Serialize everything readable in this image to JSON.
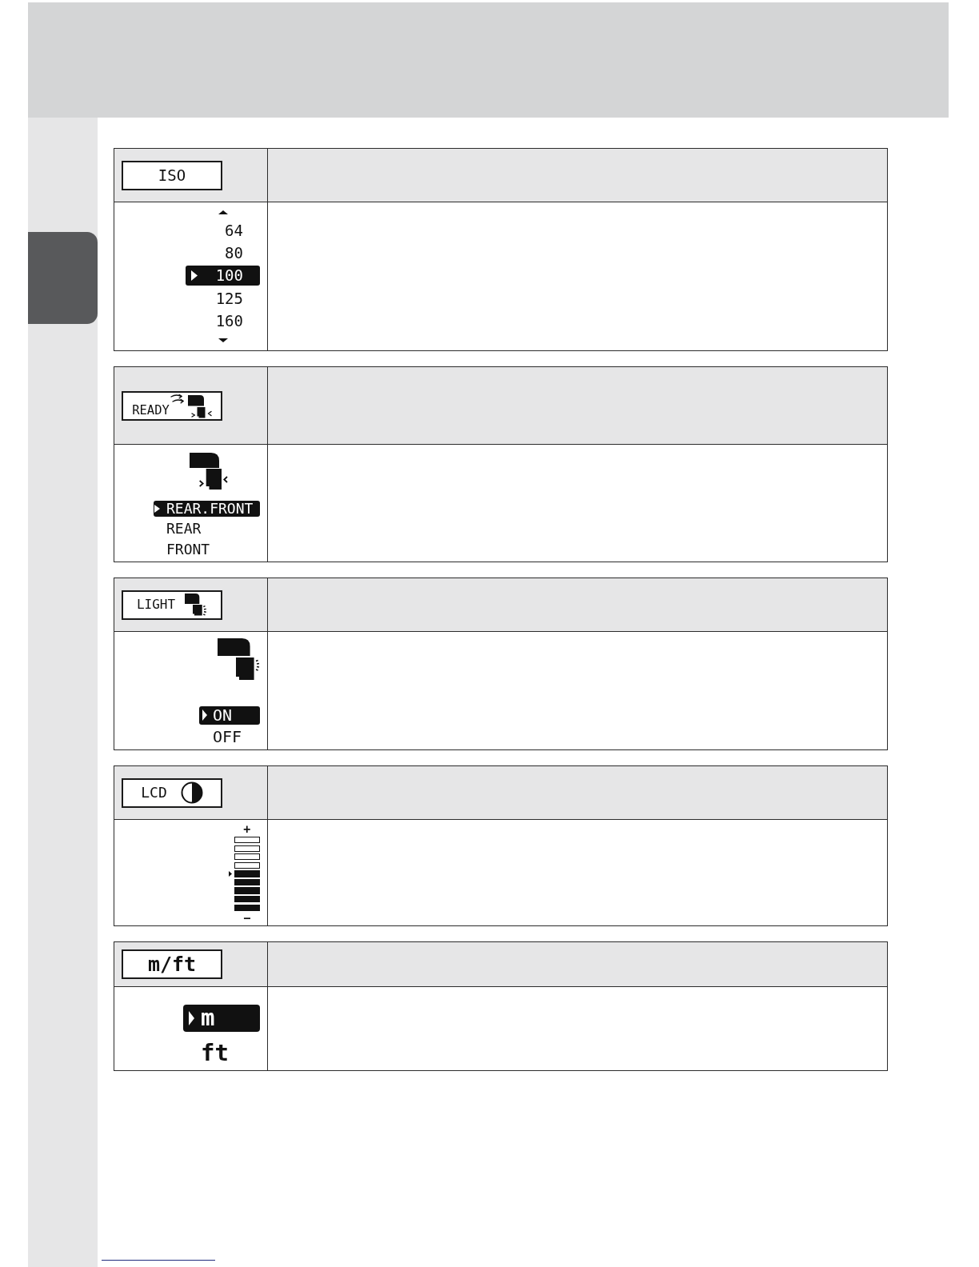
{
  "sections": [
    {
      "kind": "scroll",
      "label": "ISO",
      "options": [
        {
          "text": "64",
          "selected": false
        },
        {
          "text": "80",
          "selected": false
        },
        {
          "text": "100",
          "selected": true
        },
        {
          "text": "125",
          "selected": false
        },
        {
          "text": "160",
          "selected": false
        }
      ]
    },
    {
      "kind": "ready",
      "label": "READY",
      "options": [
        {
          "text": "REAR.FRONT",
          "selected": true
        },
        {
          "text": "REAR",
          "selected": false
        },
        {
          "text": "FRONT",
          "selected": false
        }
      ]
    },
    {
      "kind": "light",
      "label": "LIGHT",
      "options": [
        {
          "text": "ON",
          "selected": true
        },
        {
          "text": "OFF",
          "selected": false
        }
      ]
    },
    {
      "kind": "contrast",
      "label": "LCD",
      "meter": {
        "plus": "+",
        "segments": [
          {
            "filled": false
          },
          {
            "filled": false
          },
          {
            "filled": false
          },
          {
            "filled": false
          },
          {
            "filled": true
          },
          {
            "filled": true
          },
          {
            "filled": true
          },
          {
            "filled": true
          },
          {
            "filled": true
          }
        ],
        "minus": "−"
      }
    },
    {
      "kind": "units",
      "label": "m/ft",
      "options": [
        {
          "text": "m",
          "selected": true
        },
        {
          "text": "ft",
          "selected": false
        }
      ]
    }
  ]
}
